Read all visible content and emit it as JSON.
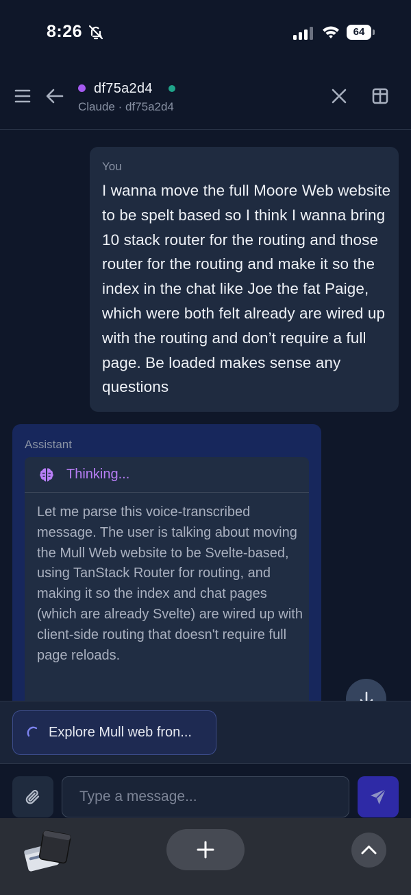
{
  "status_bar": {
    "time": "8:26",
    "battery": "64"
  },
  "header": {
    "session_name": "df75a2d4",
    "session_subtitle": "Claude · df75a2d4"
  },
  "messages": {
    "user": {
      "role": "You",
      "text": "I wanna move the full Moore Web website to be spelt based so I think I wanna bring 10 stack router for the routing and those router for the routing and make it so the index in the chat like Joe the fat Paige, which were both felt already are wired up with the routing and don’t require a full page. Be loaded makes sense any questions"
    },
    "assistant": {
      "role": "Assistant",
      "thinking_label": "Thinking...",
      "thinking_text": "Let me parse this voice-transcribed message. The user is talking about moving the Mull Web website to be Svelte-based, using TanStack Router for routing, and making it so the index and chat pages (which are already Svelte) are wired up with client-side routing that doesn't require full page reloads."
    }
  },
  "task": {
    "label": "Explore Mull web fron..."
  },
  "composer": {
    "placeholder": "Type a message..."
  },
  "colors": {
    "background": "#0f1729",
    "user_bubble": "#1f2b40",
    "assistant_bubble": "#17275c",
    "thinking_accent": "#b77ef5",
    "session_dot": "#a55af0",
    "online_dot": "#1fa48a",
    "send_button": "#2e2aa6"
  },
  "icons": {
    "status": [
      "bell-slash-icon",
      "cellular-signal-icon",
      "wifi-icon",
      "battery-icon"
    ],
    "header": [
      "menu-icon",
      "back-arrow-icon",
      "close-icon",
      "split-view-icon"
    ],
    "chat": [
      "brain-icon",
      "spinner-icon",
      "arrow-down-icon",
      "paperclip-icon",
      "send-icon"
    ],
    "browser": [
      "tabs-icon",
      "plus-icon",
      "chevron-up-icon"
    ]
  }
}
